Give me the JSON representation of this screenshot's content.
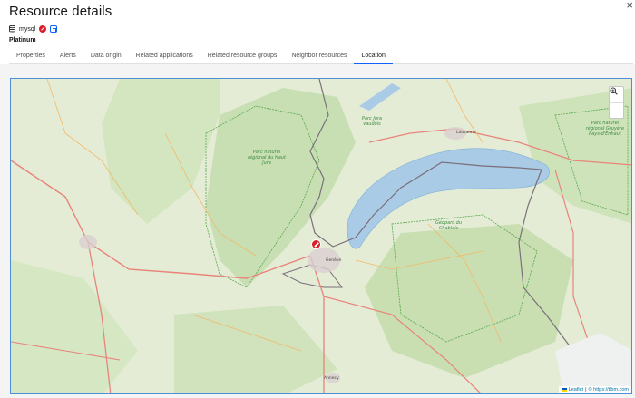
{
  "header": {
    "title": "Resource details",
    "close_label": "×"
  },
  "resource": {
    "name": "mysql",
    "tier": "Platinum"
  },
  "tabs": [
    {
      "label": "Properties"
    },
    {
      "label": "Alerts"
    },
    {
      "label": "Data origin"
    },
    {
      "label": "Related applications"
    },
    {
      "label": "Related resource groups"
    },
    {
      "label": "Neighbor resources"
    },
    {
      "label": "Location"
    }
  ],
  "active_tab": "Location",
  "map": {
    "zoom_in": "+",
    "zoom_out": "−",
    "attribution_leaflet": "Leaflet",
    "attribution_sep": "|",
    "attribution_osm": "© https://tlbm.com",
    "labels": {
      "parc_haut_jura": "Parc naturel régional du Haut Jura",
      "parc_jura_vaudois": "Parc Jura vaudois",
      "parc_gruyere": "Parc naturel régional Gruyère Pays-d'Enhaut",
      "geoparc_chablais": "Géoparc du Chablais",
      "lausanne": "Lausanne",
      "geneve": "Genève",
      "annecy": "Annecy"
    }
  }
}
